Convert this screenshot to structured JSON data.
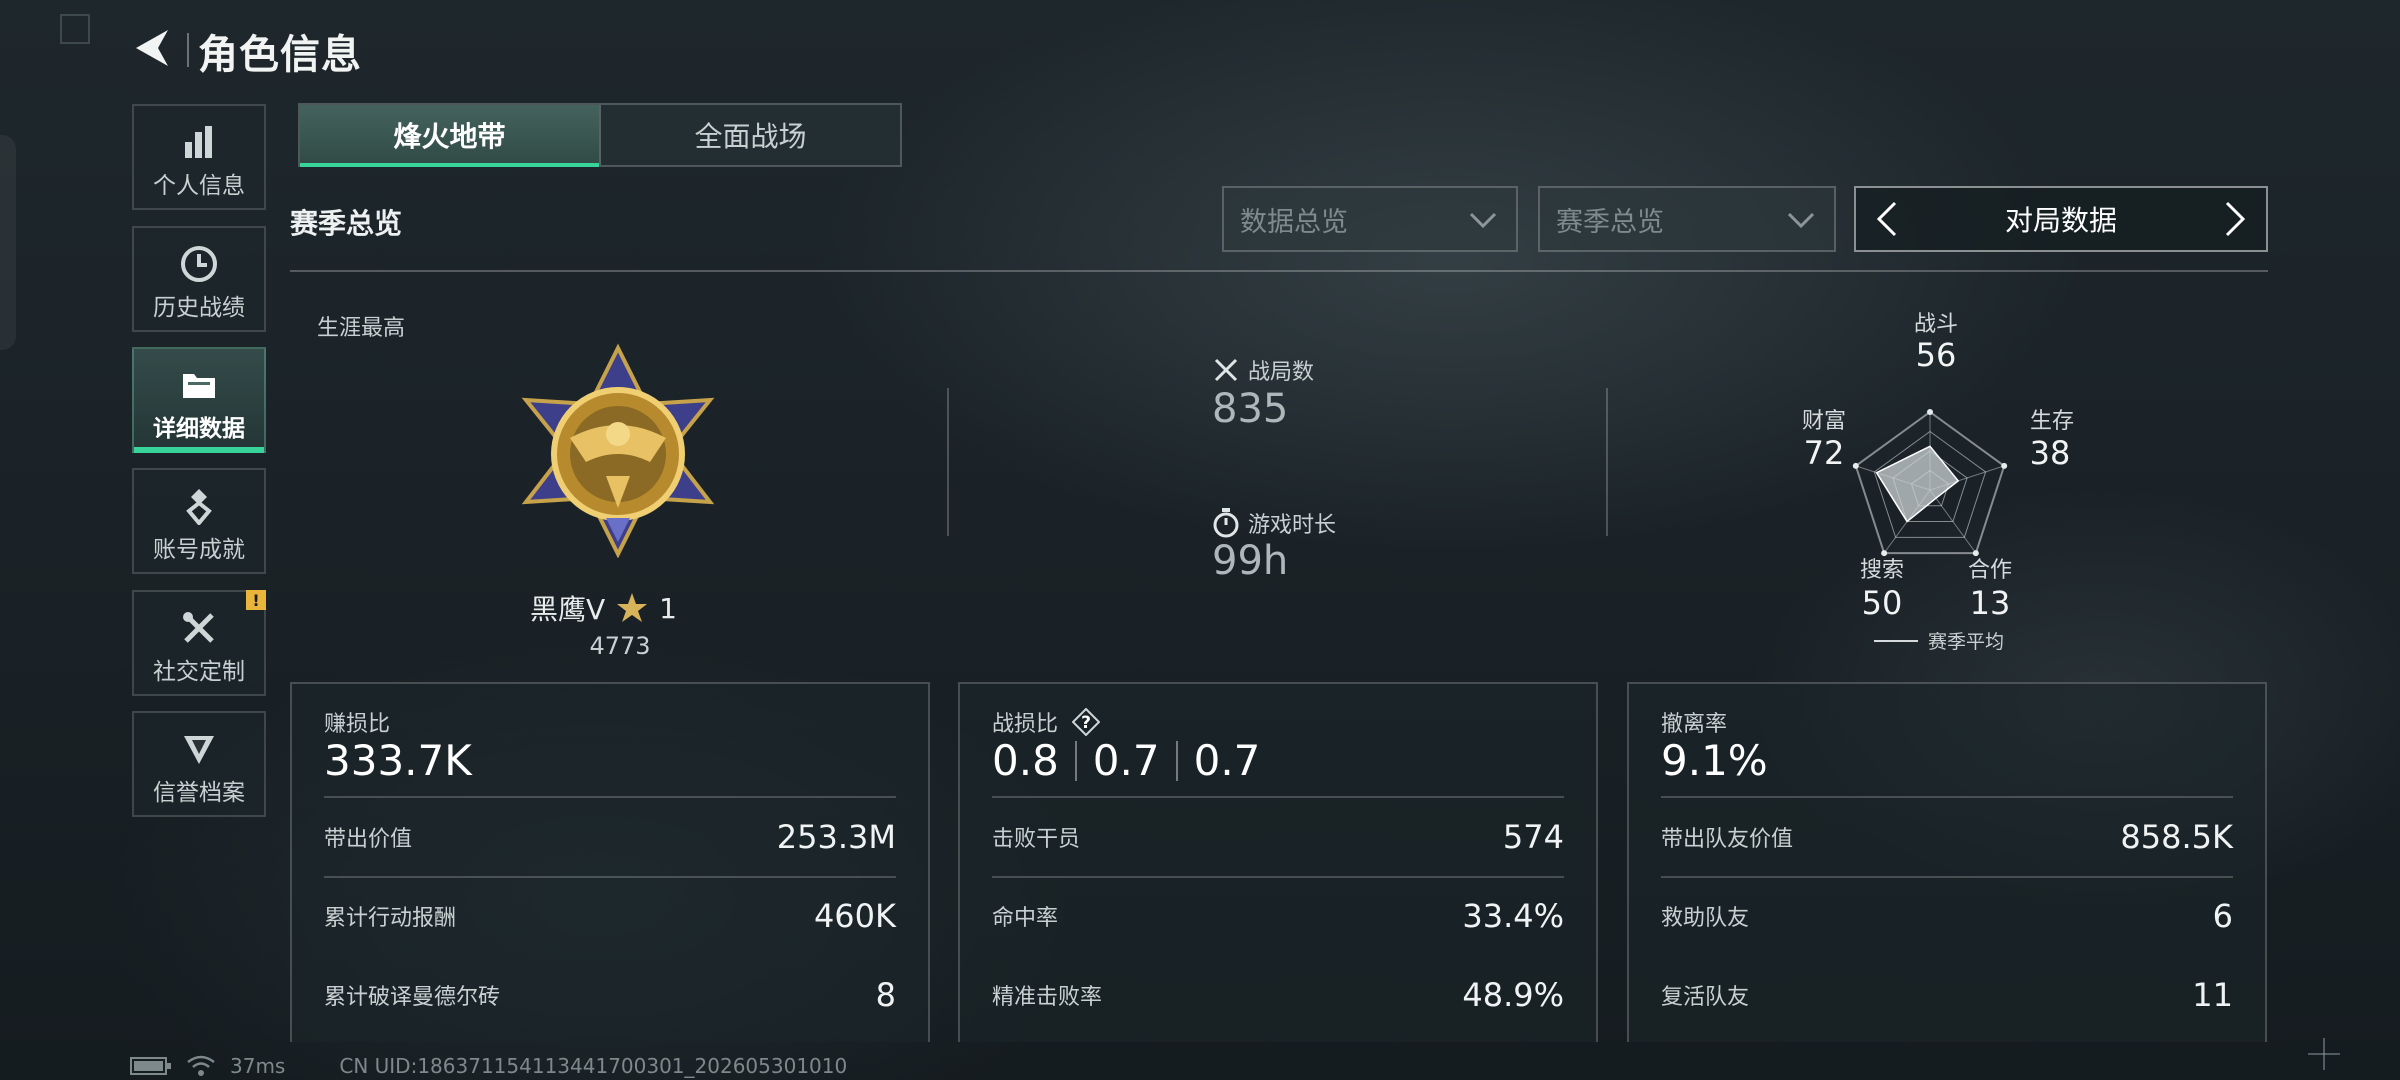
{
  "header": {
    "title": "角色信息"
  },
  "sidebar": {
    "items": [
      {
        "label": "个人信息",
        "icon": "bar-chart-icon"
      },
      {
        "label": "历史战绩",
        "icon": "history-clock-icon"
      },
      {
        "label": "详细数据",
        "icon": "folder-icon",
        "active": true
      },
      {
        "label": "账号成就",
        "icon": "achievement-badge-icon"
      },
      {
        "label": "社交定制",
        "icon": "tools-icon",
        "badge": "!"
      },
      {
        "label": "信誉档案",
        "icon": "shield-crest-icon"
      }
    ]
  },
  "mode_tabs": [
    {
      "label": "烽火地带",
      "active": true
    },
    {
      "label": "全面战场",
      "active": false
    }
  ],
  "section_title": "赛季总览",
  "filters": {
    "dropdown1": "数据总览",
    "dropdown2": "赛季总览",
    "nav_label": "对局数据"
  },
  "overview": {
    "career_label": "生涯最高",
    "rank_name": "黑鹰V",
    "stars": "1",
    "rank_score": "4773",
    "matches_label": "战局数",
    "matches_value": "835",
    "playtime_label": "游戏时长",
    "playtime_value": "99h"
  },
  "radar": {
    "axes": [
      {
        "label": "战斗",
        "value": "56"
      },
      {
        "label": "生存",
        "value": "38"
      },
      {
        "label": "合作",
        "value": "13"
      },
      {
        "label": "搜索",
        "value": "50"
      },
      {
        "label": "财富",
        "value": "72"
      }
    ],
    "legend": "赛季平均"
  },
  "cards": [
    {
      "title": "赚损比",
      "main": "333.7K",
      "rows": [
        {
          "label": "带出价值",
          "value": "253.3M"
        },
        {
          "label": "累计行动报酬",
          "value": "460K"
        },
        {
          "label": "累计破译曼德尔砖",
          "value": "8"
        }
      ]
    },
    {
      "title": "战损比",
      "main_values": [
        "0.8",
        "0.7",
        "0.7"
      ],
      "help": "?",
      "rows": [
        {
          "label": "击败干员",
          "value": "574"
        },
        {
          "label": "命中率",
          "value": "33.4%"
        },
        {
          "label": "精准击败率",
          "value": "48.9%"
        }
      ]
    },
    {
      "title": "撤离率",
      "main": "9.1%",
      "rows": [
        {
          "label": "带出队友价值",
          "value": "858.5K"
        },
        {
          "label": "救助队友",
          "value": "6"
        },
        {
          "label": "复活队友",
          "value": "11"
        }
      ]
    }
  ],
  "footer": {
    "ping": "37ms",
    "uid": "CN UID:1863711541134417003​01_202605301010"
  },
  "colors": {
    "accent_green": "#39d49a",
    "badge_yellow": "#e9b53a",
    "panel_border": "#4a5558"
  }
}
